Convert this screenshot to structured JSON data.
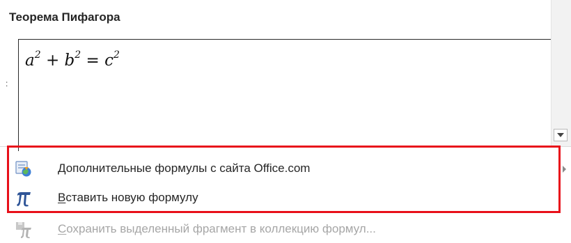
{
  "gallery": {
    "title": "Теорема Пифагора",
    "formula": {
      "a": "a",
      "plus": " + ",
      "b": "b",
      "equals": " = ",
      "c": "c",
      "exponent": "2"
    },
    "left_glyph": ":"
  },
  "menu": {
    "items": [
      {
        "first_letter": "Д",
        "rest": "ополнительные формулы с сайта Office.com",
        "icon": "office-com-formulas-icon",
        "has_submenu": true,
        "enabled": true
      },
      {
        "first_letter": "В",
        "rest": "ставить новую формулу",
        "icon": "pi-icon",
        "enabled": true
      },
      {
        "first_letter": "С",
        "rest": "охранить выделенный фрагмент в коллекцию формул...",
        "icon": "save-formula-icon",
        "enabled": false
      }
    ]
  },
  "colors": {
    "highlight": "#e8101a",
    "pi_blue": "#2f5597",
    "disabled_text": "#a6a6a6"
  }
}
